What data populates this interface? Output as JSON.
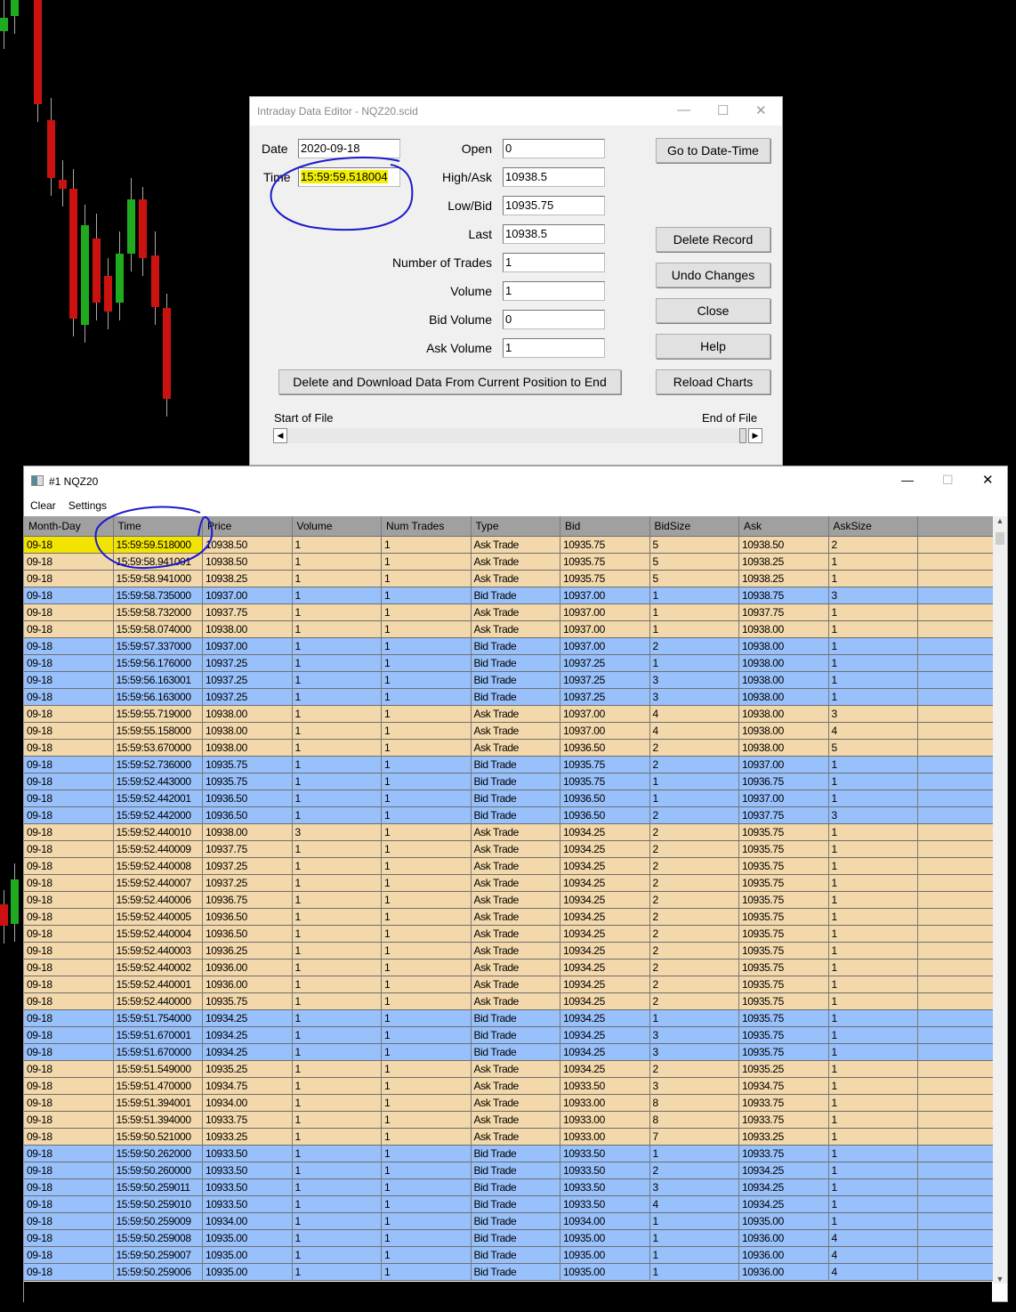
{
  "dialog": {
    "title": "Intraday Data Editor - NQZ20.scid",
    "date_label": "Date",
    "date_value": "2020-09-18",
    "time_label": "Time",
    "time_value": "15:59:59.518004",
    "fields": [
      {
        "label": "Open",
        "value": "0"
      },
      {
        "label": "High/Ask",
        "value": "10938.5"
      },
      {
        "label": "Low/Bid",
        "value": "10935.75"
      },
      {
        "label": "Last",
        "value": "10938.5"
      },
      {
        "label": "Number of Trades",
        "value": "1"
      },
      {
        "label": "Volume",
        "value": "1"
      },
      {
        "label": "Bid Volume",
        "value": "0"
      },
      {
        "label": "Ask Volume",
        "value": "1"
      }
    ],
    "buttons": {
      "goto": "Go to Date-Time",
      "delete": "Delete  Record",
      "undo": "Undo Changes",
      "close": "Close",
      "help": "Help",
      "reload": "Reload Charts",
      "download": "Delete and Download Data From Current Position to End"
    },
    "start_of_file": "Start of File",
    "end_of_file": "End of File"
  },
  "window": {
    "title": "#1 NQZ20",
    "menu": [
      "Clear",
      "Settings"
    ],
    "columns": [
      "Month-Day",
      "Time",
      "Price",
      "Volume",
      "Num Trades",
      "Type",
      "Bid",
      "BidSize",
      "Ask",
      "AskSize"
    ],
    "rows": [
      [
        "09-18",
        "15:59:59.518000",
        "10938.50",
        "1",
        "1",
        "Ask Trade",
        "10935.75",
        "5",
        "10938.50",
        "2"
      ],
      [
        "09-18",
        "15:59:58.941001",
        "10938.50",
        "1",
        "1",
        "Ask Trade",
        "10935.75",
        "5",
        "10938.25",
        "1"
      ],
      [
        "09-18",
        "15:59:58.941000",
        "10938.25",
        "1",
        "1",
        "Ask Trade",
        "10935.75",
        "5",
        "10938.25",
        "1"
      ],
      [
        "09-18",
        "15:59:58.735000",
        "10937.00",
        "1",
        "1",
        "Bid Trade",
        "10937.00",
        "1",
        "10938.75",
        "3"
      ],
      [
        "09-18",
        "15:59:58.732000",
        "10937.75",
        "1",
        "1",
        "Ask Trade",
        "10937.00",
        "1",
        "10937.75",
        "1"
      ],
      [
        "09-18",
        "15:59:58.074000",
        "10938.00",
        "1",
        "1",
        "Ask Trade",
        "10937.00",
        "1",
        "10938.00",
        "1"
      ],
      [
        "09-18",
        "15:59:57.337000",
        "10937.00",
        "1",
        "1",
        "Bid Trade",
        "10937.00",
        "2",
        "10938.00",
        "1"
      ],
      [
        "09-18",
        "15:59:56.176000",
        "10937.25",
        "1",
        "1",
        "Bid Trade",
        "10937.25",
        "1",
        "10938.00",
        "1"
      ],
      [
        "09-18",
        "15:59:56.163001",
        "10937.25",
        "1",
        "1",
        "Bid Trade",
        "10937.25",
        "3",
        "10938.00",
        "1"
      ],
      [
        "09-18",
        "15:59:56.163000",
        "10937.25",
        "1",
        "1",
        "Bid Trade",
        "10937.25",
        "3",
        "10938.00",
        "1"
      ],
      [
        "09-18",
        "15:59:55.719000",
        "10938.00",
        "1",
        "1",
        "Ask Trade",
        "10937.00",
        "4",
        "10938.00",
        "3"
      ],
      [
        "09-18",
        "15:59:55.158000",
        "10938.00",
        "1",
        "1",
        "Ask Trade",
        "10937.00",
        "4",
        "10938.00",
        "4"
      ],
      [
        "09-18",
        "15:59:53.670000",
        "10938.00",
        "1",
        "1",
        "Ask Trade",
        "10936.50",
        "2",
        "10938.00",
        "5"
      ],
      [
        "09-18",
        "15:59:52.736000",
        "10935.75",
        "1",
        "1",
        "Bid Trade",
        "10935.75",
        "2",
        "10937.00",
        "1"
      ],
      [
        "09-18",
        "15:59:52.443000",
        "10935.75",
        "1",
        "1",
        "Bid Trade",
        "10935.75",
        "1",
        "10936.75",
        "1"
      ],
      [
        "09-18",
        "15:59:52.442001",
        "10936.50",
        "1",
        "1",
        "Bid Trade",
        "10936.50",
        "1",
        "10937.00",
        "1"
      ],
      [
        "09-18",
        "15:59:52.442000",
        "10936.50",
        "1",
        "1",
        "Bid Trade",
        "10936.50",
        "2",
        "10937.75",
        "3"
      ],
      [
        "09-18",
        "15:59:52.440010",
        "10938.00",
        "3",
        "1",
        "Ask Trade",
        "10934.25",
        "2",
        "10935.75",
        "1"
      ],
      [
        "09-18",
        "15:59:52.440009",
        "10937.75",
        "1",
        "1",
        "Ask Trade",
        "10934.25",
        "2",
        "10935.75",
        "1"
      ],
      [
        "09-18",
        "15:59:52.440008",
        "10937.25",
        "1",
        "1",
        "Ask Trade",
        "10934.25",
        "2",
        "10935.75",
        "1"
      ],
      [
        "09-18",
        "15:59:52.440007",
        "10937.25",
        "1",
        "1",
        "Ask Trade",
        "10934.25",
        "2",
        "10935.75",
        "1"
      ],
      [
        "09-18",
        "15:59:52.440006",
        "10936.75",
        "1",
        "1",
        "Ask Trade",
        "10934.25",
        "2",
        "10935.75",
        "1"
      ],
      [
        "09-18",
        "15:59:52.440005",
        "10936.50",
        "1",
        "1",
        "Ask Trade",
        "10934.25",
        "2",
        "10935.75",
        "1"
      ],
      [
        "09-18",
        "15:59:52.440004",
        "10936.50",
        "1",
        "1",
        "Ask Trade",
        "10934.25",
        "2",
        "10935.75",
        "1"
      ],
      [
        "09-18",
        "15:59:52.440003",
        "10936.25",
        "1",
        "1",
        "Ask Trade",
        "10934.25",
        "2",
        "10935.75",
        "1"
      ],
      [
        "09-18",
        "15:59:52.440002",
        "10936.00",
        "1",
        "1",
        "Ask Trade",
        "10934.25",
        "2",
        "10935.75",
        "1"
      ],
      [
        "09-18",
        "15:59:52.440001",
        "10936.00",
        "1",
        "1",
        "Ask Trade",
        "10934.25",
        "2",
        "10935.75",
        "1"
      ],
      [
        "09-18",
        "15:59:52.440000",
        "10935.75",
        "1",
        "1",
        "Ask Trade",
        "10934.25",
        "2",
        "10935.75",
        "1"
      ],
      [
        "09-18",
        "15:59:51.754000",
        "10934.25",
        "1",
        "1",
        "Bid Trade",
        "10934.25",
        "1",
        "10935.75",
        "1"
      ],
      [
        "09-18",
        "15:59:51.670001",
        "10934.25",
        "1",
        "1",
        "Bid Trade",
        "10934.25",
        "3",
        "10935.75",
        "1"
      ],
      [
        "09-18",
        "15:59:51.670000",
        "10934.25",
        "1",
        "1",
        "Bid Trade",
        "10934.25",
        "3",
        "10935.75",
        "1"
      ],
      [
        "09-18",
        "15:59:51.549000",
        "10935.25",
        "1",
        "1",
        "Ask Trade",
        "10934.25",
        "2",
        "10935.25",
        "1"
      ],
      [
        "09-18",
        "15:59:51.470000",
        "10934.75",
        "1",
        "1",
        "Ask Trade",
        "10933.50",
        "3",
        "10934.75",
        "1"
      ],
      [
        "09-18",
        "15:59:51.394001",
        "10934.00",
        "1",
        "1",
        "Ask Trade",
        "10933.00",
        "8",
        "10933.75",
        "1"
      ],
      [
        "09-18",
        "15:59:51.394000",
        "10933.75",
        "1",
        "1",
        "Ask Trade",
        "10933.00",
        "8",
        "10933.75",
        "1"
      ],
      [
        "09-18",
        "15:59:50.521000",
        "10933.25",
        "1",
        "1",
        "Ask Trade",
        "10933.00",
        "7",
        "10933.25",
        "1"
      ],
      [
        "09-18",
        "15:59:50.262000",
        "10933.50",
        "1",
        "1",
        "Bid Trade",
        "10933.50",
        "1",
        "10933.75",
        "1"
      ],
      [
        "09-18",
        "15:59:50.260000",
        "10933.50",
        "1",
        "1",
        "Bid Trade",
        "10933.50",
        "2",
        "10934.25",
        "1"
      ],
      [
        "09-18",
        "15:59:50.259011",
        "10933.50",
        "1",
        "1",
        "Bid Trade",
        "10933.50",
        "3",
        "10934.25",
        "1"
      ],
      [
        "09-18",
        "15:59:50.259010",
        "10933.50",
        "1",
        "1",
        "Bid Trade",
        "10933.50",
        "4",
        "10934.25",
        "1"
      ],
      [
        "09-18",
        "15:59:50.259009",
        "10934.00",
        "1",
        "1",
        "Bid Trade",
        "10934.00",
        "1",
        "10935.00",
        "1"
      ],
      [
        "09-18",
        "15:59:50.259008",
        "10935.00",
        "1",
        "1",
        "Bid Trade",
        "10935.00",
        "1",
        "10936.00",
        "4"
      ],
      [
        "09-18",
        "15:59:50.259007",
        "10935.00",
        "1",
        "1",
        "Bid Trade",
        "10935.00",
        "1",
        "10936.00",
        "4"
      ],
      [
        "09-18",
        "15:59:50.259006",
        "10935.00",
        "1",
        "1",
        "Bid Trade",
        "10935.00",
        "1",
        "10936.00",
        "4"
      ]
    ]
  },
  "colors": {
    "ask_row": "#f2d8aa",
    "bid_row": "#98c0fb",
    "highlight": "#f2e400",
    "annotation": "#1a1acc"
  }
}
